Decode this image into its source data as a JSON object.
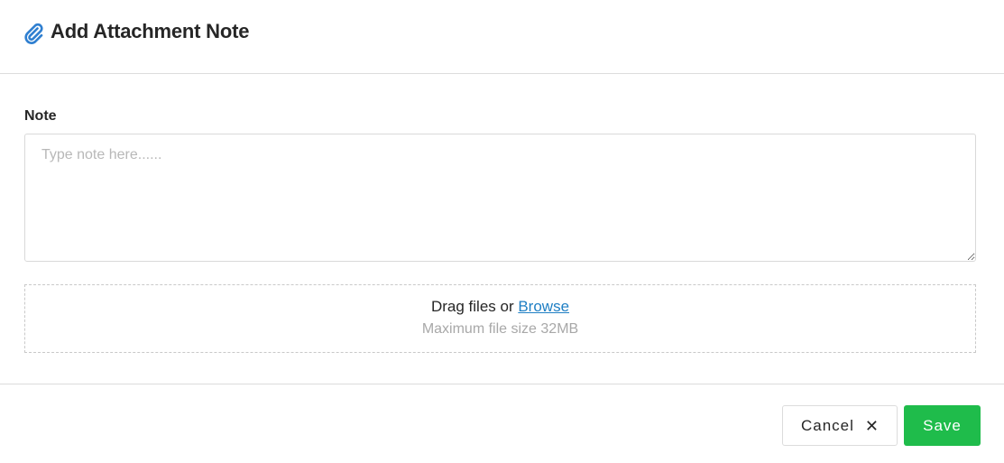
{
  "header": {
    "title": "Add Attachment Note",
    "icon": "paperclip-icon"
  },
  "note": {
    "label": "Note",
    "placeholder": "Type note here......",
    "value": ""
  },
  "dropzone": {
    "prefix": "Drag files or ",
    "browse_label": "Browse",
    "hint": "Maximum file size 32MB"
  },
  "footer": {
    "cancel_label": "Cancel",
    "cancel_icon": "close-icon",
    "save_label": "Save"
  },
  "colors": {
    "accent_link": "#1f7fc4",
    "save_bg": "#1fbc4b",
    "icon_blue": "#2f7fd0"
  }
}
